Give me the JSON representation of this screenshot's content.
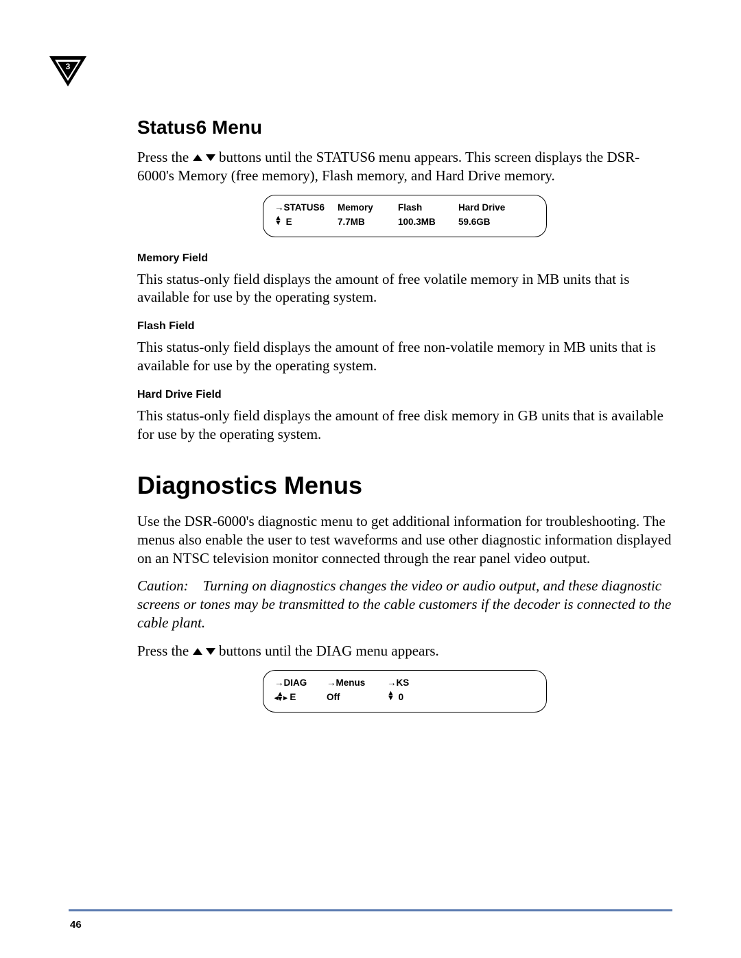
{
  "chapter_badge": "3",
  "status6": {
    "heading": "Status6 Menu",
    "intro_pre": "Press the ",
    "intro_post": " buttons until the STATUS6 menu appears. This screen displays the DSR-6000's Memory (free memory), Flash memory, and Hard Drive memory.",
    "lcd": {
      "row1": {
        "c1": "→STATUS6",
        "c2": "Memory",
        "c3": "Flash",
        "c4": "Hard Drive"
      },
      "row2": {
        "c1_symbol": "updown",
        "c1_text": "E",
        "c2": "7.7MB",
        "c3": "100.3MB",
        "c4": "59.6GB"
      }
    },
    "fields": {
      "memory": {
        "label": "Memory Field",
        "text": "This status-only field displays the amount of free volatile memory in MB units that is available for use by the operating system."
      },
      "flash": {
        "label": "Flash Field",
        "text": "This status-only field displays the amount of free non-volatile memory in MB units that is available for use by the operating system."
      },
      "harddrive": {
        "label": "Hard Drive Field",
        "text": "This status-only field displays the amount of free disk memory in GB units that is available for use by the operating system."
      }
    }
  },
  "diagnostics": {
    "heading": "Diagnostics Menus",
    "intro": "Use the DSR-6000's diagnostic menu to get additional information for troubleshooting. The menus also enable the user to test waveforms and use other diagnostic information displayed on an NTSC television monitor connected through the rear panel video output.",
    "caution": "Caution: Turning on diagnostics changes the video or audio output, and these diagnostic screens or tones may be transmitted to the cable customers if the decoder is connected to the cable plant.",
    "press_pre": "Press the ",
    "press_post": " buttons until the DIAG menu appears.",
    "lcd": {
      "row1": {
        "c1": "→DIAG",
        "c2": "→Menus",
        "c3": "→KS",
        "c4": ""
      },
      "row2": {
        "c1_symbol": "lrupdown",
        "c1_text": "E",
        "c2": "Off",
        "c3_symbol": "updown",
        "c3_text": "0",
        "c4": ""
      }
    }
  },
  "page_number": "46"
}
